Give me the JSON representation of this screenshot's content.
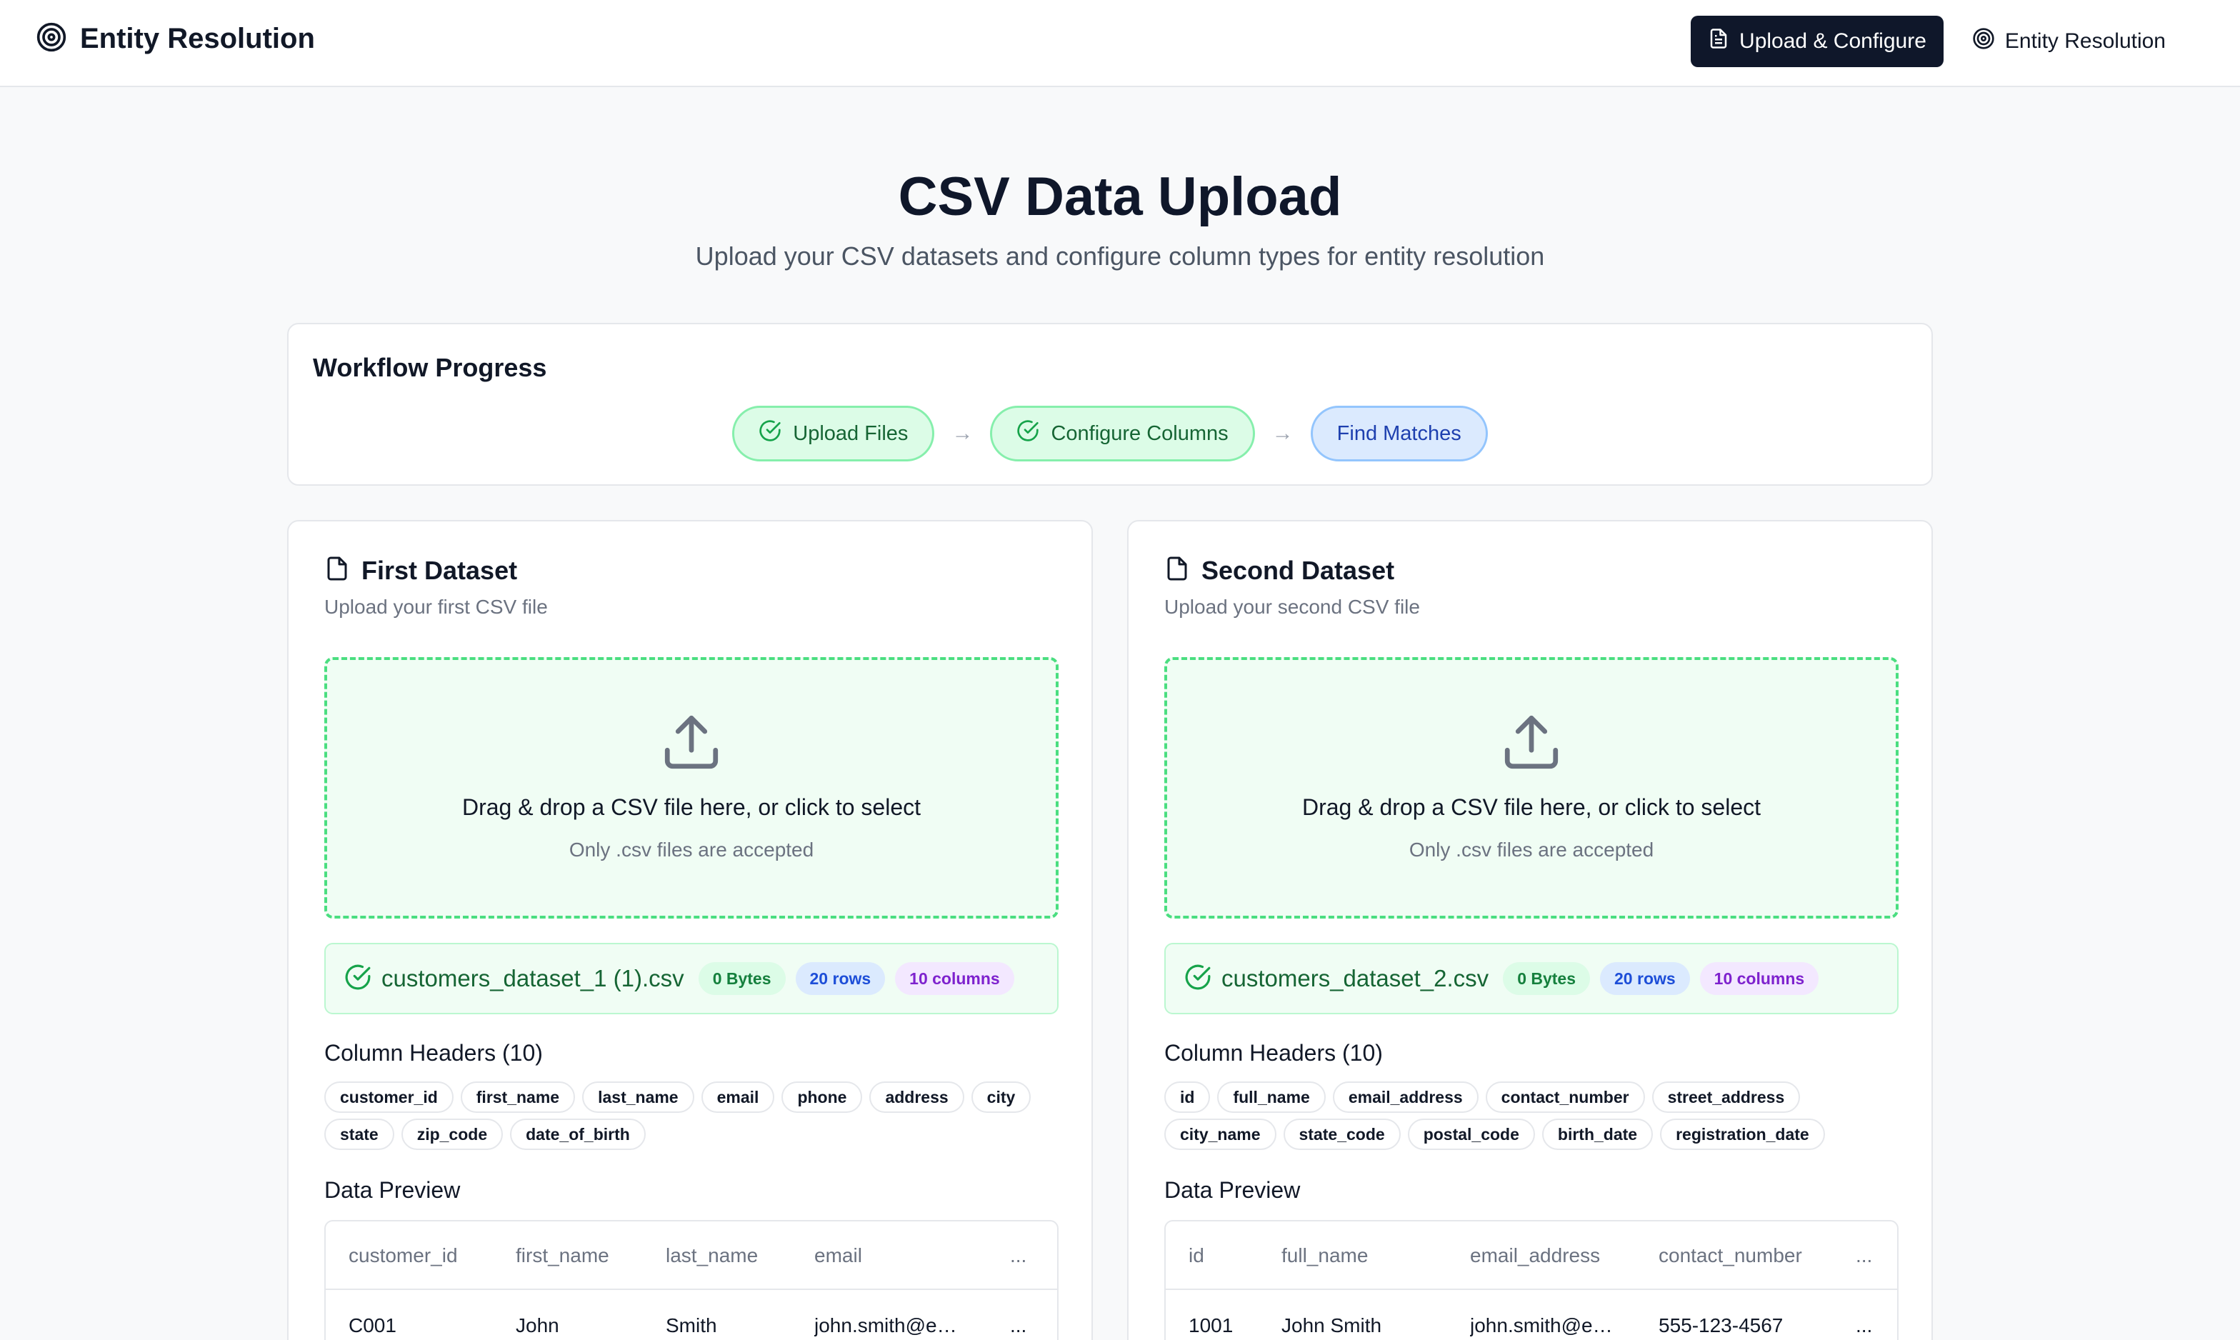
{
  "nav": {
    "brand": "Entity Resolution",
    "upload_btn": "Upload & Configure",
    "resolution_btn": "Entity Resolution"
  },
  "hero": {
    "title": "CSV Data Upload",
    "subtitle": "Upload your CSV datasets and configure column types for entity resolution"
  },
  "workflow": {
    "title": "Workflow Progress",
    "steps": [
      {
        "label": "Upload Files",
        "status": "complete"
      },
      {
        "label": "Configure Columns",
        "status": "complete"
      },
      {
        "label": "Find Matches",
        "status": "current"
      }
    ]
  },
  "datasets": [
    {
      "title": "First Dataset",
      "description": "Upload your first CSV file",
      "drop_main": "Drag & drop a CSV file here, or click to select",
      "drop_hint": "Only .csv files are accepted",
      "file_name": "customers_dataset_1 (1).csv",
      "size": "0 Bytes",
      "rows": "20 rows",
      "columns": "10 columns",
      "headers_label": "Column Headers (10)",
      "headers": [
        "customer_id",
        "first_name",
        "last_name",
        "email",
        "phone",
        "address",
        "city",
        "state",
        "zip_code",
        "date_of_birth"
      ],
      "preview_label": "Data Preview",
      "preview_columns": [
        "customer_id",
        "first_name",
        "last_name",
        "email",
        "..."
      ],
      "preview_rows": [
        [
          "C001",
          "John",
          "Smith",
          "john.smith@example.com",
          "..."
        ]
      ]
    },
    {
      "title": "Second Dataset",
      "description": "Upload your second CSV file",
      "drop_main": "Drag & drop a CSV file here, or click to select",
      "drop_hint": "Only .csv files are accepted",
      "file_name": "customers_dataset_2.csv",
      "size": "0 Bytes",
      "rows": "20 rows",
      "columns": "10 columns",
      "headers_label": "Column Headers (10)",
      "headers": [
        "id",
        "full_name",
        "email_address",
        "contact_number",
        "street_address",
        "city_name",
        "state_code",
        "postal_code",
        "birth_date",
        "registration_date"
      ],
      "preview_label": "Data Preview",
      "preview_columns": [
        "id",
        "full_name",
        "email_address",
        "contact_number",
        "..."
      ],
      "preview_rows": [
        [
          "1001",
          "John Smith",
          "john.smith@example.com",
          "555-123-4567",
          "..."
        ]
      ]
    }
  ],
  "colors": {
    "nav_active_bg": "#0f172a",
    "success_green": "#16a34a",
    "dropzone_border": "#4ade80",
    "current_step_blue": "#1e40af"
  }
}
